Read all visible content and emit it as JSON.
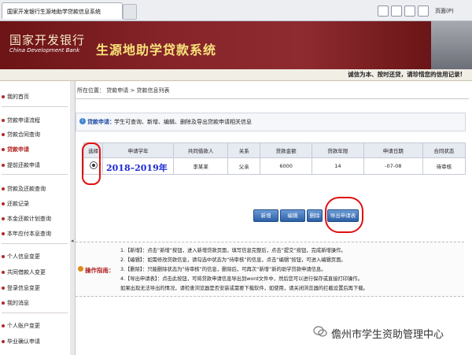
{
  "browser": {
    "tab_title": "国家开发银行生源地助学贷款信息系统",
    "page_menu": "页面(P)",
    "tab2_label": "×"
  },
  "header": {
    "bank_name_cn": "国家开发银行",
    "bank_name_en": "China Development Bank",
    "system_title": "生源地助学贷款系统",
    "slogan": "诚信为本、按时还贷，请珍惜您的信用记录!"
  },
  "sidebar": {
    "items": [
      {
        "label": "我的首页"
      },
      {
        "label": "贷款申请流程"
      },
      {
        "label": "贷款合同查询"
      },
      {
        "label": "贷款申请"
      },
      {
        "label": "提前还款申请"
      },
      {
        "label": "贷款及还款查询"
      },
      {
        "label": "还款记录"
      },
      {
        "label": "本金还款计划查询"
      },
      {
        "label": "本年应付本息查询"
      },
      {
        "label": "个人信息变更"
      },
      {
        "label": "共同借款人变更"
      },
      {
        "label": "登录信息变更"
      },
      {
        "label": "我的消息"
      },
      {
        "label": "个人账户变更"
      },
      {
        "label": "毕业确认申请"
      }
    ]
  },
  "main": {
    "breadcrumb": "所在位置：  贷款申请 > 贷款信息列表",
    "info_label": "贷款申请：",
    "info_text": "学生可查询、新增、编辑、删除及导出贷款申请相关信息",
    "table": {
      "headers": [
        "选择",
        "申请学年",
        "共同借款人",
        "关系",
        "贷款金额",
        "贷款年限",
        "申请日期",
        "合同状态"
      ],
      "rows": [
        {
          "year": "2018–2019年",
          "co_borrower": "李某某",
          "relation": "父亲",
          "amount": "6000",
          "years": "14",
          "date": "-07-08",
          "status": "待审核"
        }
      ]
    },
    "buttons": {
      "add": "新增",
      "edit": "编辑",
      "delete": "删除",
      "export": "导出申请表"
    },
    "help": {
      "label": "操作指南：",
      "lines": [
        "1.【新增】：点击“新增”按钮，进入新增贷款页面，填写信息完整后，点击“提交”按钮，完成新增操作。",
        "2.【编辑】：如需修改贷款信息，请勾选中状态为“待审核”的信息，点击“编辑”按钮，可进入编辑页面。",
        "3.【删除】：只能删除状态为“待审核”的信息，删除后，可再次“新增”新的助学贷款申请信息。",
        "4.【导出申请表】：点击此按钮，可将贷款申请信息导出到word文件中，然后您可以进行保存或直接打印操作。",
        "   如果出现无法导出的情况，请检查浏览器是否安装或需要下载软件，如使用，请关闭浏览器的拦截设置后再下载。"
      ]
    }
  },
  "watermark": {
    "text": "儋州市学生资助管理中心"
  },
  "colors": {
    "banner": "#7a1b1d",
    "title_yellow": "#f7e27a",
    "button_blue": "#2c5fa6",
    "highlight_red": "#e01010"
  }
}
